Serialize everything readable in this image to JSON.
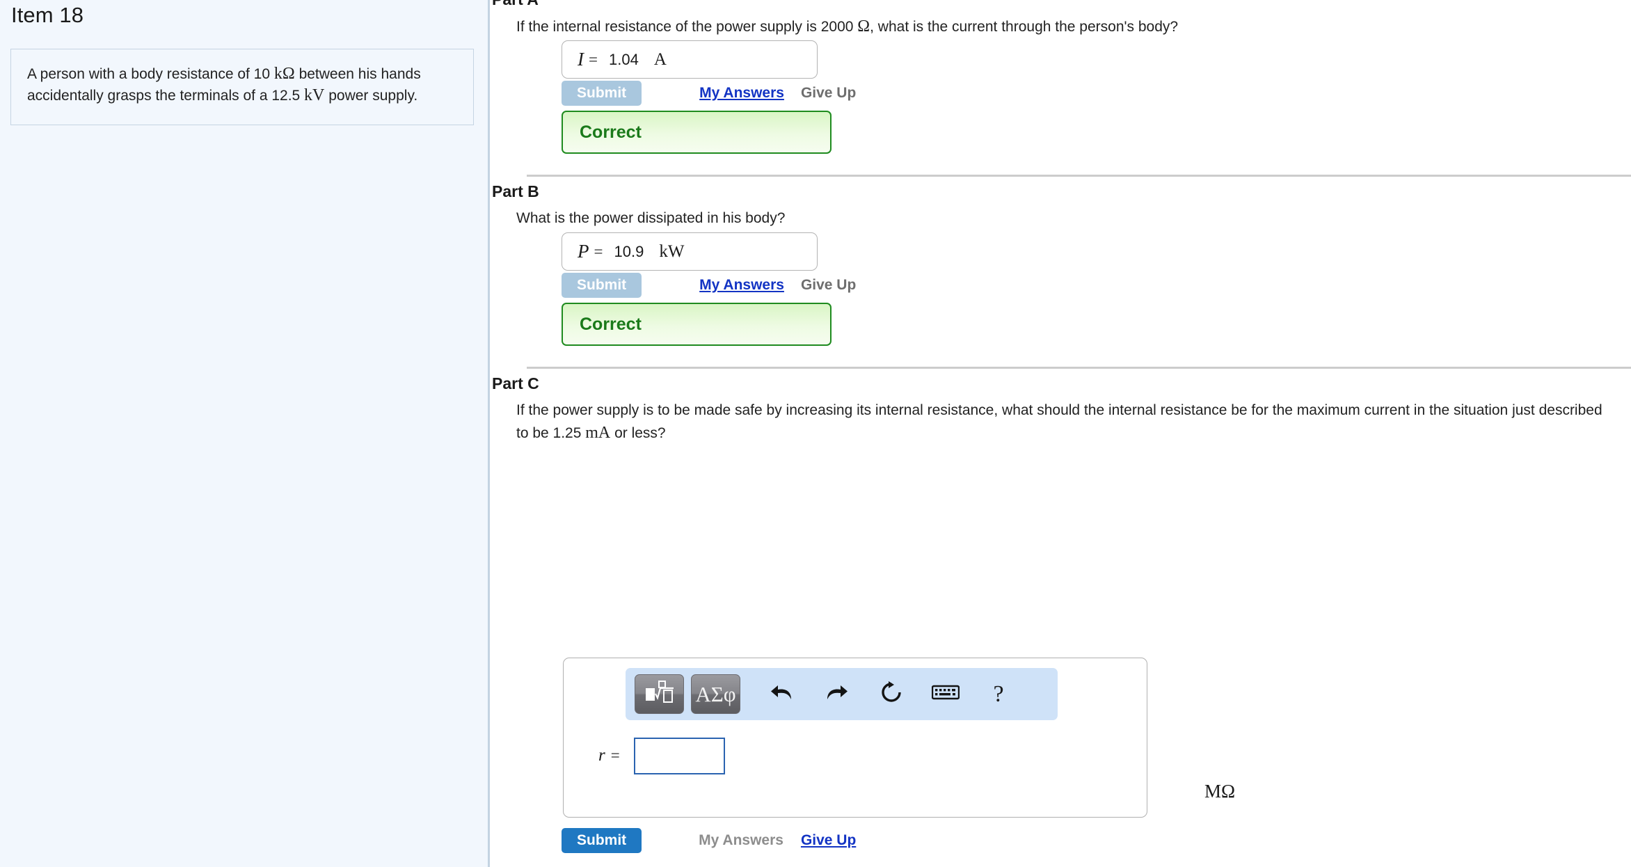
{
  "sidebar": {
    "item_title": "Item 18",
    "problem_text_pre": "A person with a body resistance of 10 ",
    "problem_unit_1": "kΩ",
    "problem_text_mid": " between his hands accidentally grasps the terminals of a 12.5 ",
    "problem_unit_2": "kV",
    "problem_text_post": " power supply."
  },
  "parts": {
    "a": {
      "heading": "Part A",
      "question": "If the internal resistance of the power supply is 2000 ",
      "question_unit": "Ω",
      "question_tail": ", what is the current through the person's body?",
      "variable": "I",
      "equals": "=",
      "value": "1.04",
      "unit": "A",
      "submit_label": "Submit",
      "my_answers_label": "My Answers",
      "give_up_label": "Give Up",
      "feedback": "Correct"
    },
    "b": {
      "heading": "Part B",
      "question": "What is the power dissipated in his body?",
      "variable": "P",
      "equals": "=",
      "value": "10.9",
      "unit": "kW",
      "submit_label": "Submit",
      "my_answers_label": "My Answers",
      "give_up_label": "Give Up",
      "feedback": "Correct"
    },
    "c": {
      "heading": "Part C",
      "question_pre": "If the power supply is to be made safe by increasing its internal resistance, what should the internal resistance be for the maximum current in the situation just described to be 1.25 ",
      "question_unit": "mA",
      "question_post": " or less?",
      "variable": "r",
      "equals": "=",
      "input_value": "",
      "unit": "MΩ",
      "submit_label": "Submit",
      "my_answers_label": "My Answers",
      "give_up_label": "Give Up",
      "toolbar": {
        "template_icon": "math-template-icon",
        "greek_label": "ΑΣφ",
        "undo_icon": "undo-icon",
        "redo_icon": "redo-icon",
        "reset_icon": "reset-icon",
        "keyboard_icon": "keyboard-icon",
        "help_label": "?"
      }
    }
  },
  "colors": {
    "sidebar_bg": "#f2f7fd",
    "submit_active": "#1f78c2",
    "submit_disabled": "#a9c7de",
    "correct_border": "#1f8b1f",
    "correct_text": "#1a7a1a",
    "link_blue": "#1334c4",
    "toolbar_bg": "#cfe2f8",
    "input_border": "#2a63b0"
  }
}
